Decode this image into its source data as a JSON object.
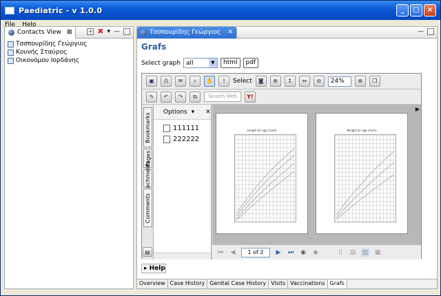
{
  "window": {
    "title": "Paediatric - v 1.0.0"
  },
  "menu": [
    "File",
    "Help"
  ],
  "contacts_view": {
    "tab_label": "Contacts View",
    "items": [
      "Τσσπουρίδης Γεώργιος",
      "Κουνής Σταύρος",
      "Οικονόμου Ιορδάνης"
    ]
  },
  "editor": {
    "tab_label": "Τσσπουρίδης Γεώργιος",
    "heading": "Grafs",
    "select_label": "Select graph",
    "select_value": "all",
    "html_button": "html",
    "pdf_button": "pdf"
  },
  "viewer": {
    "select_tool_label": "Select",
    "zoom_value": "24%",
    "search_placeholder": "Search Web",
    "options_label": "Options",
    "side_tabs": [
      "Bookmarks",
      "Pages",
      "Attachments",
      "Comments"
    ],
    "bookmarks": [
      "111111",
      "222222"
    ],
    "page_indicator": "1 of 2",
    "pages": [
      {
        "title": "Length for age charts"
      },
      {
        "title": "Weight for age charts"
      }
    ]
  },
  "help_label": "Help",
  "bottom_tabs": [
    "Overview",
    "Case History",
    "Genital Case History",
    "Visits",
    "Vaccinations",
    "Grafs"
  ],
  "active_tab": "Grafs"
}
